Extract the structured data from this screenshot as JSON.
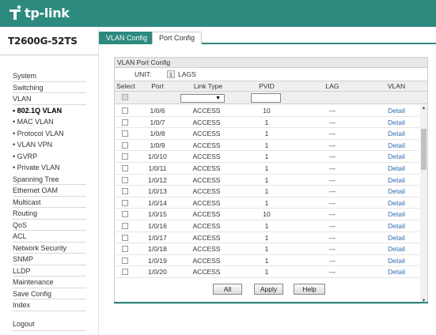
{
  "brand": {
    "name": "tp-link"
  },
  "model": "T2600G-52TS",
  "tabs": [
    {
      "label": "VLAN Config",
      "active": true
    },
    {
      "label": "Port Config",
      "active": false
    }
  ],
  "menu": [
    {
      "label": "System",
      "sub": false,
      "active": false
    },
    {
      "label": "Switching",
      "sub": false,
      "active": false
    },
    {
      "label": "VLAN",
      "sub": false,
      "active": false
    },
    {
      "label": "• 802.1Q VLAN",
      "sub": true,
      "active": true
    },
    {
      "label": "• MAC VLAN",
      "sub": true,
      "active": false
    },
    {
      "label": "• Protocol VLAN",
      "sub": true,
      "active": false
    },
    {
      "label": "• VLAN VPN",
      "sub": true,
      "active": false
    },
    {
      "label": "• GVRP",
      "sub": true,
      "active": false
    },
    {
      "label": "• Private VLAN",
      "sub": true,
      "active": false
    },
    {
      "label": "Spanning Tree",
      "sub": false,
      "active": false
    },
    {
      "label": "Ethernet OAM",
      "sub": false,
      "active": false
    },
    {
      "label": "Multicast",
      "sub": false,
      "active": false
    },
    {
      "label": "Routing",
      "sub": false,
      "active": false
    },
    {
      "label": "QoS",
      "sub": false,
      "active": false
    },
    {
      "label": "ACL",
      "sub": false,
      "active": false
    },
    {
      "label": "Network Security",
      "sub": false,
      "active": false
    },
    {
      "label": "SNMP",
      "sub": false,
      "active": false
    },
    {
      "label": "LLDP",
      "sub": false,
      "active": false
    },
    {
      "label": "Maintenance",
      "sub": false,
      "active": false
    },
    {
      "label": "Save Config",
      "sub": false,
      "active": false
    },
    {
      "label": "Index",
      "sub": false,
      "active": false
    }
  ],
  "logout": "Logout",
  "panel": {
    "title": "VLAN Port Config",
    "unit_label": "UNIT:",
    "unit_value": "1",
    "lags_label": "LAGS",
    "columns": [
      "Select",
      "Port",
      "Link Type",
      "PVID",
      "LAG",
      "VLAN"
    ],
    "link_type_filter": "",
    "pvid_filter": ""
  },
  "rows": [
    {
      "port": "1/0/6",
      "link_type": "ACCESS",
      "pvid": "10",
      "lag": "---",
      "vlan": "Detail"
    },
    {
      "port": "1/0/7",
      "link_type": "ACCESS",
      "pvid": "1",
      "lag": "---",
      "vlan": "Detail"
    },
    {
      "port": "1/0/8",
      "link_type": "ACCESS",
      "pvid": "1",
      "lag": "---",
      "vlan": "Detail"
    },
    {
      "port": "1/0/9",
      "link_type": "ACCESS",
      "pvid": "1",
      "lag": "---",
      "vlan": "Detail"
    },
    {
      "port": "1/0/10",
      "link_type": "ACCESS",
      "pvid": "1",
      "lag": "---",
      "vlan": "Detail"
    },
    {
      "port": "1/0/11",
      "link_type": "ACCESS",
      "pvid": "1",
      "lag": "---",
      "vlan": "Detail"
    },
    {
      "port": "1/0/12",
      "link_type": "ACCESS",
      "pvid": "1",
      "lag": "---",
      "vlan": "Detail"
    },
    {
      "port": "1/0/13",
      "link_type": "ACCESS",
      "pvid": "1",
      "lag": "---",
      "vlan": "Detail"
    },
    {
      "port": "1/0/14",
      "link_type": "ACCESS",
      "pvid": "1",
      "lag": "---",
      "vlan": "Detail"
    },
    {
      "port": "1/0/15",
      "link_type": "ACCESS",
      "pvid": "10",
      "lag": "---",
      "vlan": "Detail"
    },
    {
      "port": "1/0/16",
      "link_type": "ACCESS",
      "pvid": "1",
      "lag": "---",
      "vlan": "Detail"
    },
    {
      "port": "1/0/17",
      "link_type": "ACCESS",
      "pvid": "1",
      "lag": "---",
      "vlan": "Detail"
    },
    {
      "port": "1/0/18",
      "link_type": "ACCESS",
      "pvid": "1",
      "lag": "---",
      "vlan": "Detail"
    },
    {
      "port": "1/0/19",
      "link_type": "ACCESS",
      "pvid": "1",
      "lag": "---",
      "vlan": "Detail"
    },
    {
      "port": "1/0/20",
      "link_type": "ACCESS",
      "pvid": "1",
      "lag": "---",
      "vlan": "Detail"
    }
  ],
  "buttons": {
    "all": "All",
    "apply": "Apply",
    "help": "Help"
  },
  "colors": {
    "brand_teal": "#2d8a7e",
    "link_blue": "#2f6ab0"
  }
}
